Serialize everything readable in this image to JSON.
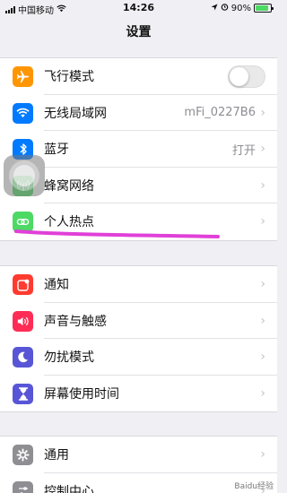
{
  "status_bar": {
    "carrier": "中国移动",
    "time": "14:26",
    "battery": "90%",
    "battery_level": 0.9
  },
  "nav": {
    "title": "设置"
  },
  "groups": [
    {
      "rows": [
        {
          "label": "飞行模式",
          "icon": "airplane-icon",
          "icon_color": "#ff9500",
          "control": "toggle",
          "toggle_on": false
        },
        {
          "label": "无线局域网",
          "icon": "wifi-icon",
          "icon_color": "#007aff",
          "value": "mFi_0227B6"
        },
        {
          "label": "蓝牙",
          "icon": "bluetooth-icon",
          "icon_color": "#007aff",
          "value": "打开"
        },
        {
          "label": "蜂窝网络",
          "icon": "cellular-icon",
          "icon_color": "#4cd964"
        },
        {
          "label": "个人热点",
          "icon": "hotspot-icon",
          "icon_color": "#4cd964"
        }
      ]
    },
    {
      "rows": [
        {
          "label": "通知",
          "icon": "notification-icon",
          "icon_color": "#ff3b30"
        },
        {
          "label": "声音与触感",
          "icon": "sound-icon",
          "icon_color": "#ff2d55"
        },
        {
          "label": "勿扰模式",
          "icon": "moon-icon",
          "icon_color": "#5856d6"
        },
        {
          "label": "屏幕使用时间",
          "icon": "hourglass-icon",
          "icon_color": "#5856d6"
        }
      ]
    },
    {
      "rows": [
        {
          "label": "通用",
          "icon": "gear-icon",
          "icon_color": "#8e8e93"
        },
        {
          "label": "控制中心",
          "icon": "control-center-icon",
          "icon_color": "#8e8e93"
        }
      ]
    }
  ],
  "annotation_color": "#e040d8",
  "watermark": "Baidu经验"
}
